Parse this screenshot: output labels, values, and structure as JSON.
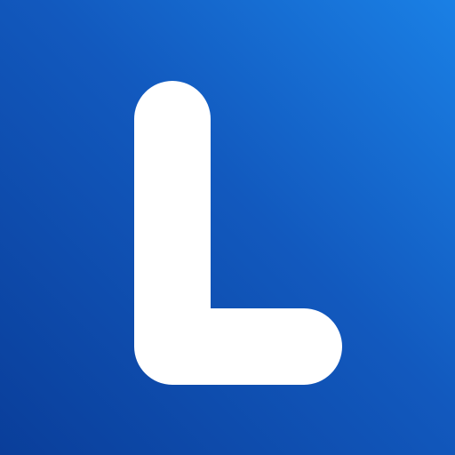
{
  "icon": {
    "glyph": "L",
    "name": "letter-l-logo-icon",
    "colors": {
      "gradient_start": "#1A80E5",
      "gradient_mid": "#1259BE",
      "gradient_end": "#0A3E9A",
      "glyph": "#FFFFFF"
    }
  }
}
